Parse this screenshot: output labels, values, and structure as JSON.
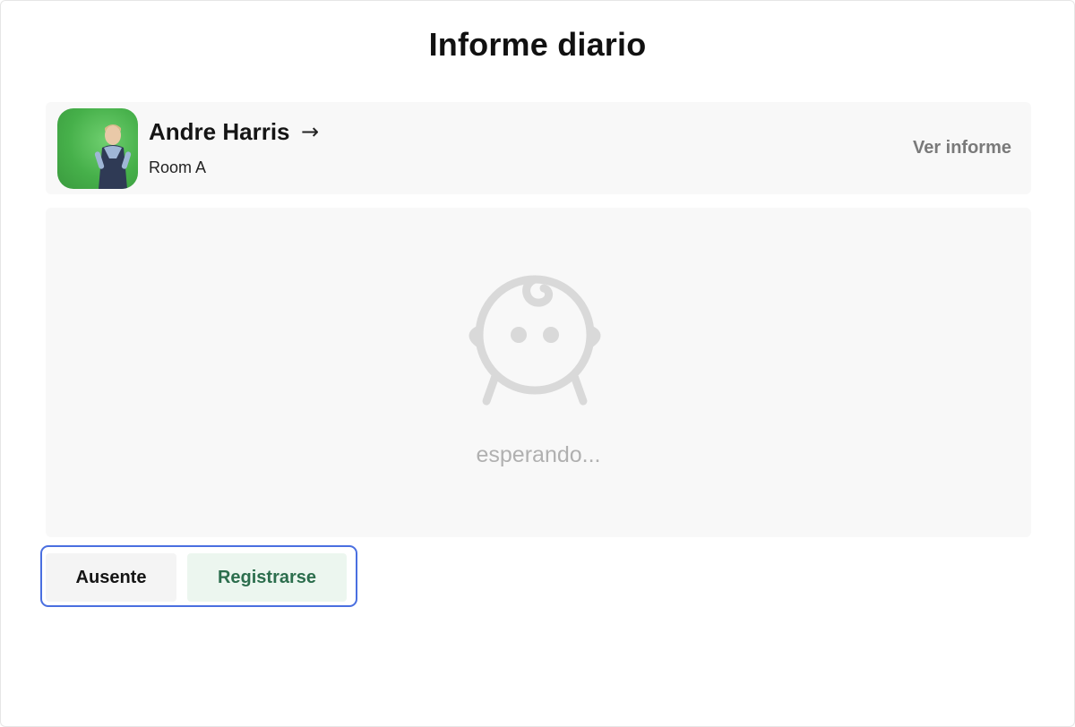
{
  "header": {
    "title": "Informe diario"
  },
  "student": {
    "name": "Andre Harris",
    "arrow": "→",
    "room": "Room A",
    "view_report_label": "Ver informe"
  },
  "status": {
    "waiting_text": "esperando..."
  },
  "actions": {
    "absent_label": "Ausente",
    "register_label": "Registrarse"
  },
  "icons": {
    "avatar": "student-photo",
    "arrow": "arrow-right-icon",
    "status": "baby-icon"
  },
  "colors": {
    "accent_border": "#4a6fe0",
    "register_text": "#2c6e4d",
    "register_bg": "#ecf6ef",
    "panel_bg": "#f8f8f8",
    "muted_text": "#b0b0b0"
  }
}
